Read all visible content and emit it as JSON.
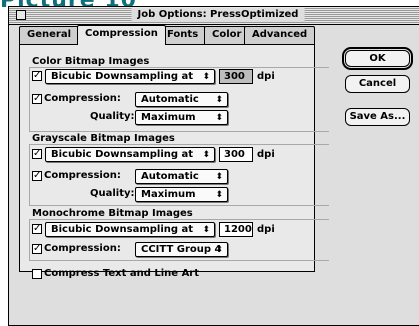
{
  "background_title": "Picture 10",
  "window": {
    "title": "Job Options: PressOptimized"
  },
  "tabs": [
    "General",
    "Compression",
    "Fonts",
    "Color",
    "Advanced"
  ],
  "buttons": {
    "ok": "OK",
    "cancel": "Cancel",
    "save_as": "Save As..."
  },
  "color": {
    "title": "Color Bitmap Images",
    "downsample_method": "Bicubic Downsampling at",
    "downsample_checked": true,
    "resolution": "300",
    "unit": "dpi",
    "compression_label": "Compression:",
    "compression_checked": true,
    "compression_value": "Automatic",
    "quality_label": "Quality:",
    "quality_value": "Maximum"
  },
  "grayscale": {
    "title": "Grayscale Bitmap Images",
    "downsample_method": "Bicubic Downsampling at",
    "downsample_checked": true,
    "resolution": "300",
    "unit": "dpi",
    "compression_label": "Compression:",
    "compression_checked": true,
    "compression_value": "Automatic",
    "quality_label": "Quality:",
    "quality_value": "Maximum"
  },
  "monochrome": {
    "title": "Monochrome Bitmap Images",
    "downsample_method": "Bicubic Downsampling at",
    "downsample_checked": true,
    "resolution": "1200",
    "unit": "dpi",
    "compression_label": "Compression:",
    "compression_checked": true,
    "compression_value": "CCITT Group 4"
  },
  "compress_text": {
    "label": "Compress Text and Line Art",
    "checked": false
  },
  "glyphs": {
    "check": "✓",
    "popup_arrow": "⬍"
  }
}
